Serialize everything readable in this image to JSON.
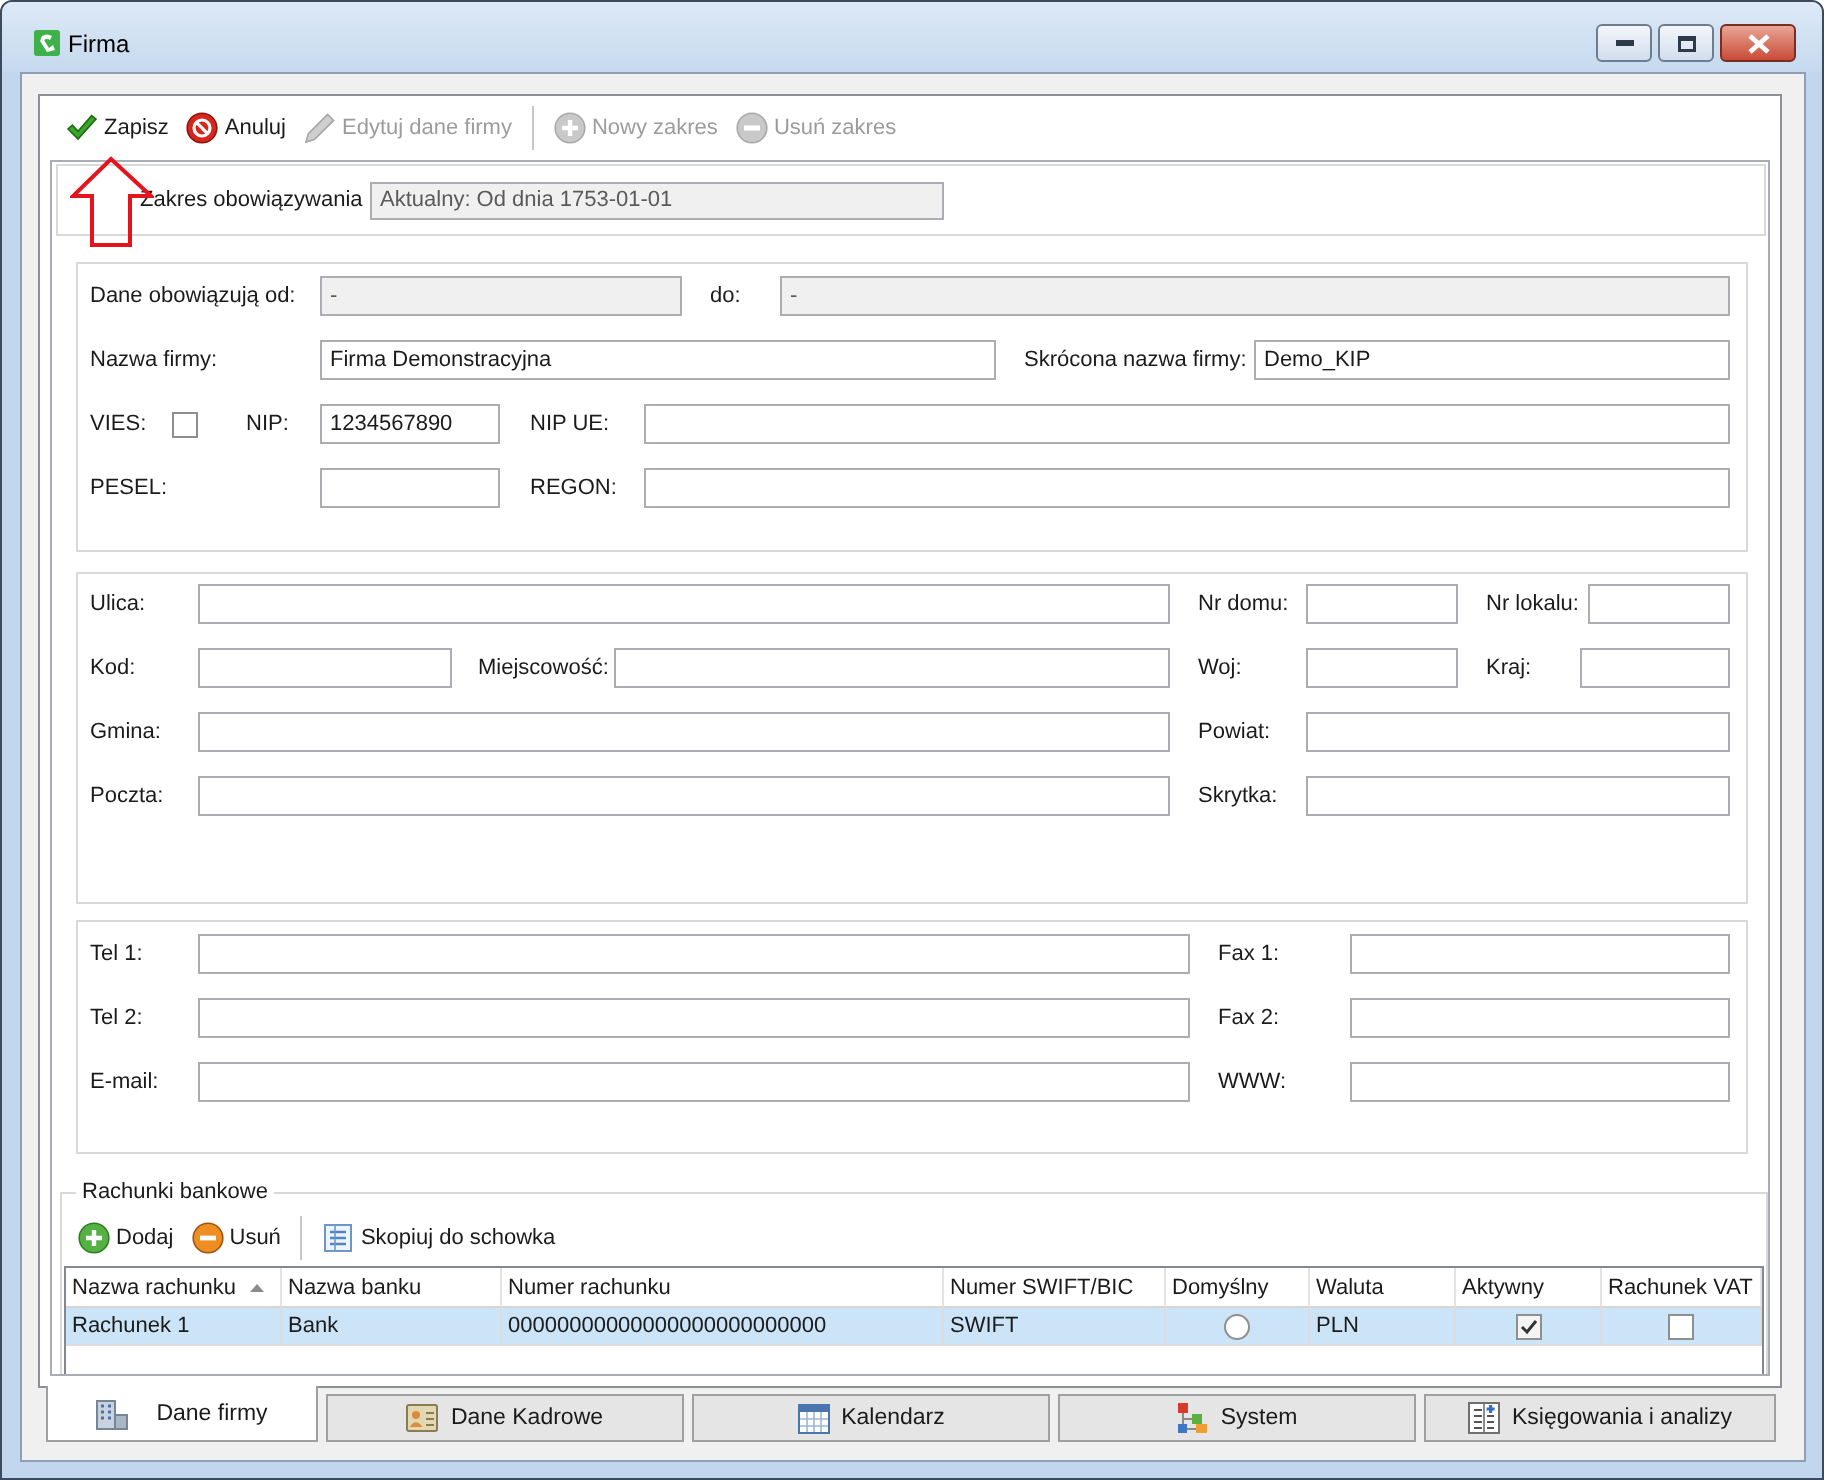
{
  "window": {
    "title": "Firma"
  },
  "toolbar": {
    "groups": [
      {
        "items": [
          {
            "kind": "save",
            "label": "Zapisz",
            "disabled": false
          },
          {
            "kind": "cancel",
            "label": "Anuluj",
            "disabled": false
          },
          {
            "kind": "edit",
            "label": "Edytuj dane firmy",
            "disabled": true
          }
        ]
      },
      {
        "items": [
          {
            "kind": "add",
            "label": "Nowy zakres",
            "disabled": true
          },
          {
            "kind": "remove",
            "label": "Usuń zakres",
            "disabled": true
          }
        ]
      }
    ]
  },
  "annotations": [
    {
      "kind": "arrow_up"
    }
  ],
  "validity": {
    "label": "Zakres obowiązywania",
    "value": "Aktualny: Od dnia 1753-01-01",
    "disabled": true
  },
  "sections": [
    {
      "rows": [
        {
          "fields": [
            {
              "kind": "text",
              "label": "Dane obowiązują od:",
              "value": "-",
              "disabled": true
            },
            {
              "kind": "text",
              "label": "do:",
              "value": "-",
              "disabled": true
            }
          ]
        },
        {
          "fields": [
            {
              "kind": "text",
              "label": "Nazwa firmy:",
              "value": "Firma Demonstracyjna",
              "disabled": false
            },
            {
              "kind": "text",
              "label": "Skrócona nazwa firmy:",
              "value": "Demo_KIP",
              "disabled": false
            }
          ]
        },
        {
          "fields": [
            {
              "kind": "checkbox",
              "label": "VIES:",
              "checked": false
            },
            {
              "kind": "text",
              "label": "NIP:",
              "value": "1234567890",
              "disabled": false
            },
            {
              "kind": "text",
              "label": "NIP UE:",
              "disabled": false
            }
          ]
        },
        {
          "fields": [
            {
              "kind": "text",
              "label": "PESEL:",
              "disabled": false
            },
            {
              "kind": "text",
              "label": "REGON:",
              "disabled": false
            }
          ]
        }
      ]
    },
    {
      "rows": [
        {
          "fields": [
            {
              "kind": "text",
              "label": "Ulica:",
              "disabled": false
            },
            {
              "kind": "text",
              "label": "Nr domu:",
              "disabled": false
            },
            {
              "kind": "text",
              "label": "Nr lokalu:",
              "disabled": false
            }
          ]
        },
        {
          "fields": [
            {
              "kind": "text",
              "label": "Kod:",
              "disabled": false
            },
            {
              "kind": "text",
              "label": "Miejscowość:",
              "disabled": false
            },
            {
              "kind": "text",
              "label": "Woj:",
              "disabled": false
            },
            {
              "kind": "text",
              "label": "Kraj:",
              "disabled": false
            }
          ]
        },
        {
          "fields": [
            {
              "kind": "text",
              "label": "Gmina:",
              "disabled": false
            },
            {
              "kind": "text",
              "label": "Powiat:",
              "disabled": false
            }
          ]
        },
        {
          "fields": [
            {
              "kind": "text",
              "label": "Poczta:",
              "disabled": false
            },
            {
              "kind": "text",
              "label": "Skrytka:",
              "disabled": false
            }
          ]
        }
      ]
    },
    {
      "rows": [
        {
          "fields": [
            {
              "kind": "text",
              "label": "Tel 1:",
              "disabled": false
            },
            {
              "kind": "text",
              "label": "Fax 1:",
              "disabled": false
            }
          ]
        },
        {
          "fields": [
            {
              "kind": "text",
              "label": "Tel 2:",
              "disabled": false
            },
            {
              "kind": "text",
              "label": "Fax 2:",
              "disabled": false
            }
          ]
        },
        {
          "fields": [
            {
              "kind": "text",
              "label": "E-mail:",
              "disabled": false
            },
            {
              "kind": "text",
              "label": "WWW:",
              "disabled": false
            }
          ]
        }
      ]
    }
  ],
  "bank_accounts": {
    "legend": "Rachunki bankowe",
    "toolbar": {
      "groups": [
        {
          "items": [
            {
              "kind": "add",
              "label": "Dodaj",
              "disabled": false
            },
            {
              "kind": "remove",
              "label": "Usuń",
              "disabled": false
            }
          ]
        },
        {
          "items": [
            {
              "kind": "copy",
              "label": "Skopiuj do schowka",
              "disabled": false
            }
          ]
        }
      ]
    },
    "table": {
      "columns": [
        {
          "label": "Nazwa rachunku",
          "sorted": true
        },
        {
          "label": "Nazwa banku",
          "sorted": false
        },
        {
          "label": "Numer rachunku",
          "sorted": false
        },
        {
          "label": "Numer SWIFT/BIC",
          "sorted": false
        },
        {
          "label": "Domyślny",
          "sorted": false
        },
        {
          "label": "Waluta",
          "sorted": false
        },
        {
          "label": "Aktywny",
          "sorted": false
        },
        {
          "label": "Rachunek VAT",
          "sorted": false
        }
      ],
      "rows": [
        {
          "selected": true,
          "cells": [
            {
              "kind": "text",
              "text": "Rachunek 1"
            },
            {
              "kind": "text",
              "text": "Bank"
            },
            {
              "kind": "text",
              "text": "00000000000000000000000000"
            },
            {
              "kind": "text",
              "text": "SWIFT"
            },
            {
              "kind": "radio",
              "selected": false
            },
            {
              "kind": "text",
              "text": "PLN"
            },
            {
              "kind": "checkbox",
              "checked": true
            },
            {
              "kind": "checkbox",
              "checked": false
            }
          ]
        }
      ]
    }
  },
  "tabs": [
    {
      "kind": "company",
      "label": "Dane firmy",
      "selected": true
    },
    {
      "kind": "staff",
      "label": "Dane Kadrowe",
      "selected": false
    },
    {
      "kind": "calendar",
      "label": "Kalendarz",
      "selected": false
    },
    {
      "kind": "system",
      "label": "System",
      "selected": false
    },
    {
      "kind": "accounting",
      "label": "Księgowania i analizy",
      "selected": false
    }
  ]
}
